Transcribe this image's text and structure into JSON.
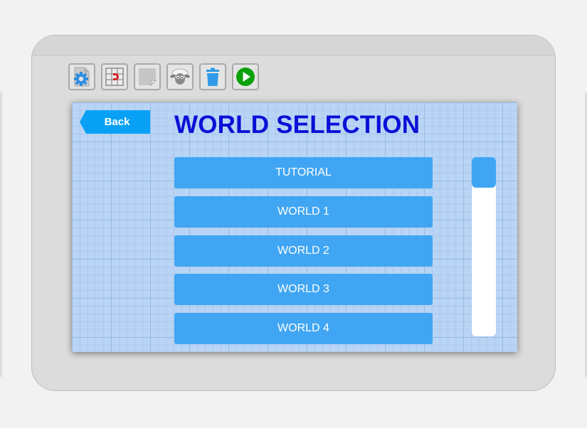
{
  "header": {
    "back_label": "Back",
    "title": "WORLD SELECTION"
  },
  "toolbar": {
    "items": [
      {
        "name": "settings",
        "icon": "settings-gear-icon"
      },
      {
        "name": "magnet-grid",
        "icon": "magnet-grid-icon"
      },
      {
        "name": "blank-page",
        "icon": "blank-page-icon"
      },
      {
        "name": "sheep",
        "icon": "sheep-icon"
      },
      {
        "name": "delete",
        "icon": "trash-icon"
      },
      {
        "name": "play",
        "icon": "play-icon"
      }
    ]
  },
  "worlds": [
    "TUTORIAL",
    "WORLD 1",
    "WORLD 2",
    "WORLD 3",
    "WORLD 4"
  ],
  "scrollbar": {
    "position": 0
  },
  "colors": {
    "accent": "#40a6f3",
    "back_button": "#09a1f5",
    "title": "#0a10d6",
    "play_green": "#0aa10a",
    "grid_background": "#b9d4f4"
  }
}
